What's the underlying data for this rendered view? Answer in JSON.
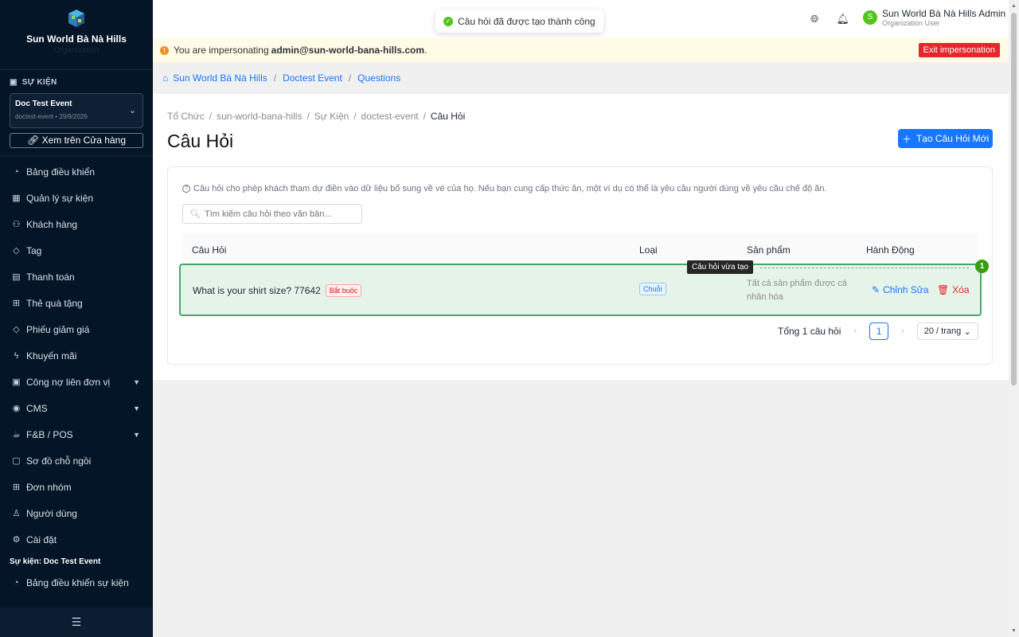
{
  "sidebar": {
    "brand_name": "Sun World Bà Nà Hills",
    "brand_sub": "Organization",
    "section_event": "SỰ KIỆN",
    "event_title": "Doc Test Event",
    "event_sub": "doctest-event • 29/8/2026",
    "store_button": "Xem trên Cửa hàng",
    "items": [
      {
        "label": "Bảng điều khiển",
        "icon": "dashboard-icon"
      },
      {
        "label": "Quản lý sự kiện",
        "icon": "calendar-icon"
      },
      {
        "label": "Khách hàng",
        "icon": "users-icon"
      },
      {
        "label": "Tag",
        "icon": "tag-icon"
      },
      {
        "label": "Thanh toán",
        "icon": "payment-icon"
      },
      {
        "label": "Thẻ quà tặng",
        "icon": "gift-icon"
      },
      {
        "label": "Phiếu giảm giá",
        "icon": "coupon-icon"
      },
      {
        "label": "Khuyến mãi",
        "icon": "promo-icon"
      },
      {
        "label": "Công nợ liên đơn vị",
        "icon": "debt-icon"
      },
      {
        "label": "CMS",
        "icon": "cms-icon"
      },
      {
        "label": "F&B / POS",
        "icon": "coffee-icon"
      },
      {
        "label": "Sơ đồ chỗ ngồi",
        "icon": "seatmap-icon"
      },
      {
        "label": "Đơn nhóm",
        "icon": "grid-icon"
      },
      {
        "label": "Người dùng",
        "icon": "user-icon"
      },
      {
        "label": "Cài đặt",
        "icon": "settings-icon"
      }
    ],
    "sub_head": "Sự kiện: Doc Test Event",
    "event_dashboard": "Bảng điều khiển sự kiện"
  },
  "topbar": {
    "toast": "Câu hỏi đã được tạo thành công",
    "user_name": "Sun World Bà Nà Hills Admin",
    "user_role": "Organization User",
    "avatar_letter": "S"
  },
  "impersonation": {
    "prefix": "You are impersonating",
    "email": "admin@sun-world-bana-hills.com",
    "suffix": ".",
    "exit_label": "Exit impersonation"
  },
  "breadcrumb_top": [
    "Sun World Bà Nà Hills",
    "Doctest Event",
    "Questions"
  ],
  "breadcrumb_main": [
    "Tổ Chức",
    "sun-world-bana-hills",
    "Sự Kiện",
    "doctest-event",
    "Câu Hỏi"
  ],
  "page": {
    "title": "Câu Hỏi",
    "new_button": "Tạo Câu Hỏi Mới",
    "hint": "Câu hỏi cho phép khách tham dự điền vào dữ liệu bổ sung về vé của họ. Nếu bạn cung cấp thức ăn, một ví dụ có thể là yêu cầu người dùng về yêu cầu chế độ ăn.",
    "search_placeholder": "Tìm kiếm câu hỏi theo văn bản..."
  },
  "table": {
    "headers": [
      "Câu Hỏi",
      "Loại",
      "Sản phẩm",
      "Hành Động"
    ],
    "row": {
      "question": "What is your shirt size? 77642",
      "required": "Bắt buộc",
      "type": "Chuỗi",
      "product": "Tất cả sản phẩm được cá nhân hóa",
      "edit": "Chỉnh Sửa",
      "delete": "Xóa"
    },
    "annotation_tip": "Câu hỏi vừa tạo",
    "annotation_badge": "1"
  },
  "pagination": {
    "total": "Tổng 1 câu hỏi",
    "current": "1",
    "page_size": "20 / trang"
  }
}
